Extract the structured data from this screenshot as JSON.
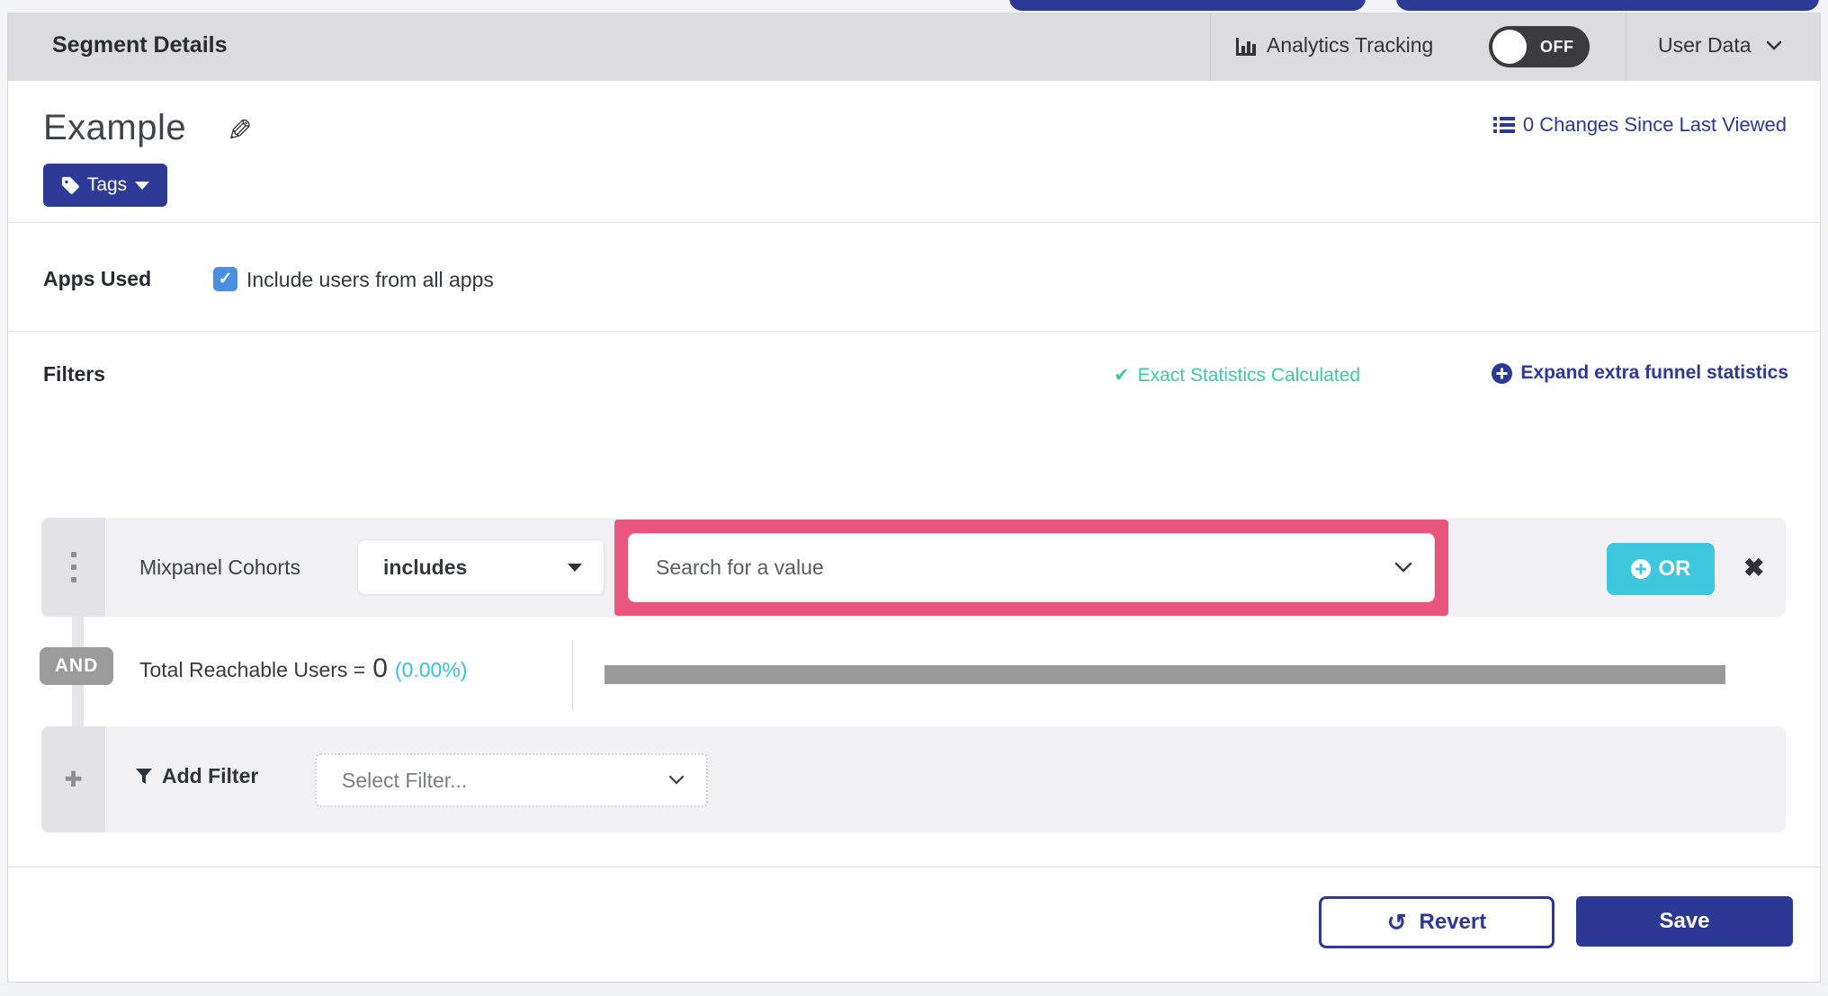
{
  "header": {
    "title": "Segment Details",
    "analytics_label": "Analytics Tracking",
    "toggle_state": "OFF",
    "user_data_label": "User Data"
  },
  "segment": {
    "name": "Example",
    "tags_label": "Tags",
    "changes_link": "0 Changes Since Last Viewed"
  },
  "apps": {
    "section_label": "Apps Used",
    "checkbox_label": "Include users from all apps",
    "checkbox_checked": true
  },
  "filters": {
    "heading": "Filters",
    "exact_statistics": "Exact Statistics Calculated",
    "expand_funnel": "Expand extra funnel statistics",
    "filter_row": {
      "field_label": "Mixpanel Cohorts",
      "operator": "includes",
      "value_placeholder": "Search for a value",
      "or_label": "OR"
    },
    "conjunction": "AND",
    "reachable_label": "Total Reachable Users =",
    "reachable_value": "0",
    "reachable_percent": "(0.00%)",
    "add_filter_label": "Add Filter",
    "select_filter_placeholder": "Select Filter..."
  },
  "footer": {
    "revert": "Revert",
    "save": "Save"
  },
  "icons": {
    "pencil": "✎",
    "check": "✔",
    "checkbox_check": "✓",
    "close": "✖",
    "plus": "✚",
    "revert": "↺"
  },
  "colors": {
    "navy": "#2d3a96",
    "teal_or": "#3fc8dd",
    "green_status": "#3fc9a6",
    "cyan_percent": "#38c2d8",
    "pink_highlight": "#e8557d",
    "checkbox_blue": "#4a90e2",
    "bar_gray": "#9a9a9a"
  }
}
